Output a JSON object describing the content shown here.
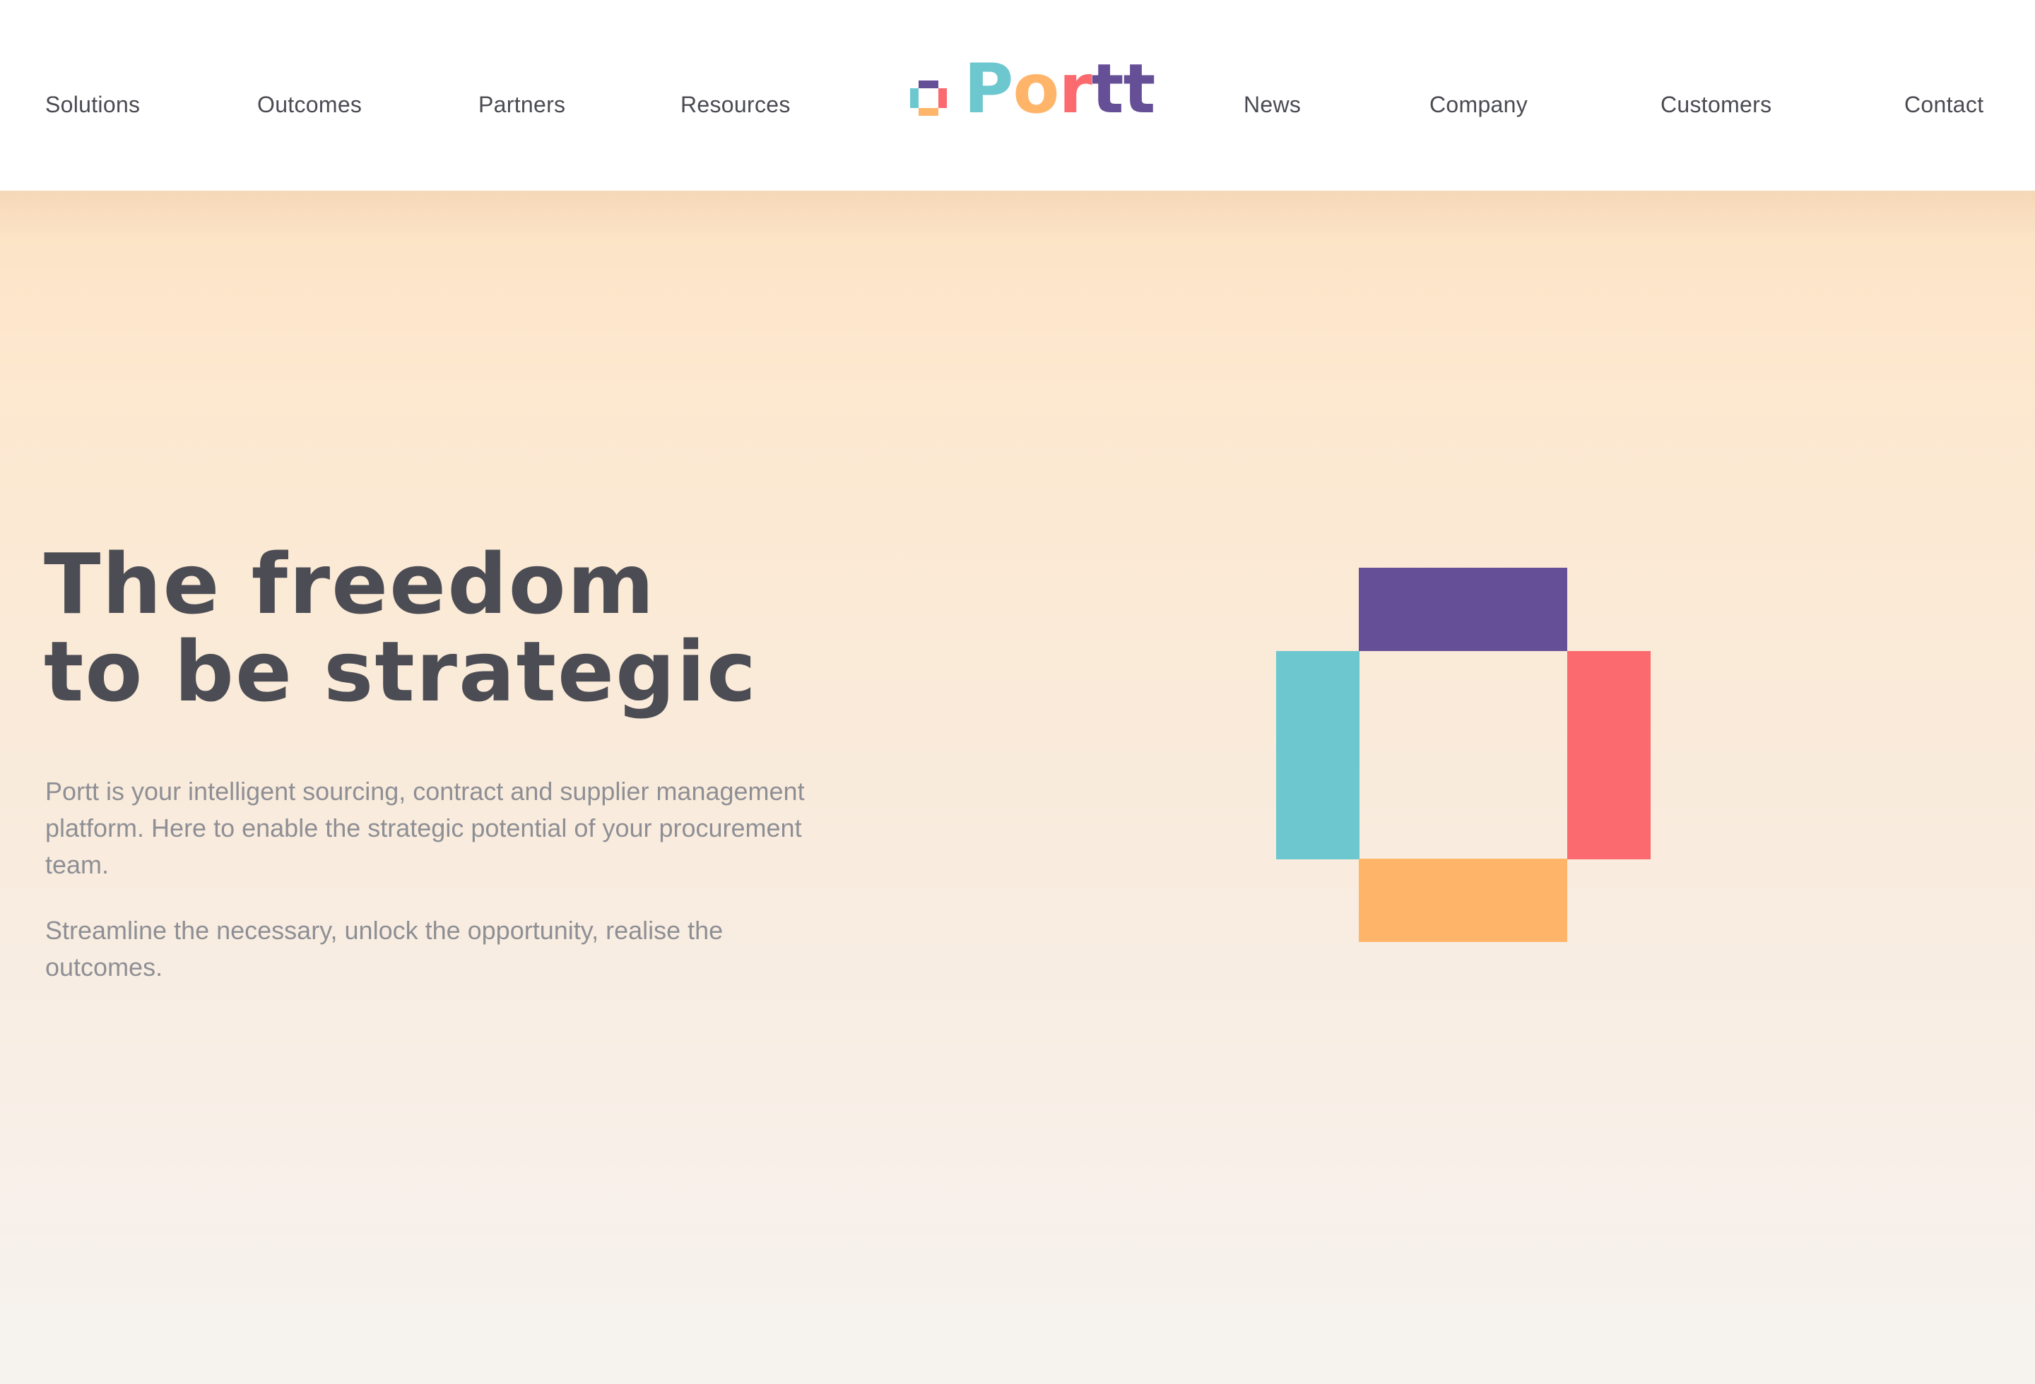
{
  "brand": {
    "name": "Portt",
    "letters": [
      "P",
      "o",
      "r",
      "t",
      "t"
    ],
    "colors": {
      "purple": "#654f96",
      "teal": "#6dc7cf",
      "coral": "#fb6a6e",
      "orange": "#feb56a",
      "text_dark": "#4c4d54",
      "text_muted": "#8e8f95"
    }
  },
  "nav": {
    "left": [
      "Solutions",
      "Outcomes",
      "Partners",
      "Resources"
    ],
    "right": [
      "News",
      "Company",
      "Customers",
      "Contact"
    ]
  },
  "hero": {
    "headline_line1": "The freedom",
    "headline_line2": "to be strategic",
    "paragraph1": "Portt is your intelligent sourcing, contract and supplier management platform. Here to enable the strategic potential of your procurement team.",
    "paragraph2": "Streamline the necessary, unlock the opportunity, realise the outcomes."
  },
  "icons": {
    "logo_mark": "portt-square-icon",
    "emblem": "portt-emblem-icon"
  }
}
